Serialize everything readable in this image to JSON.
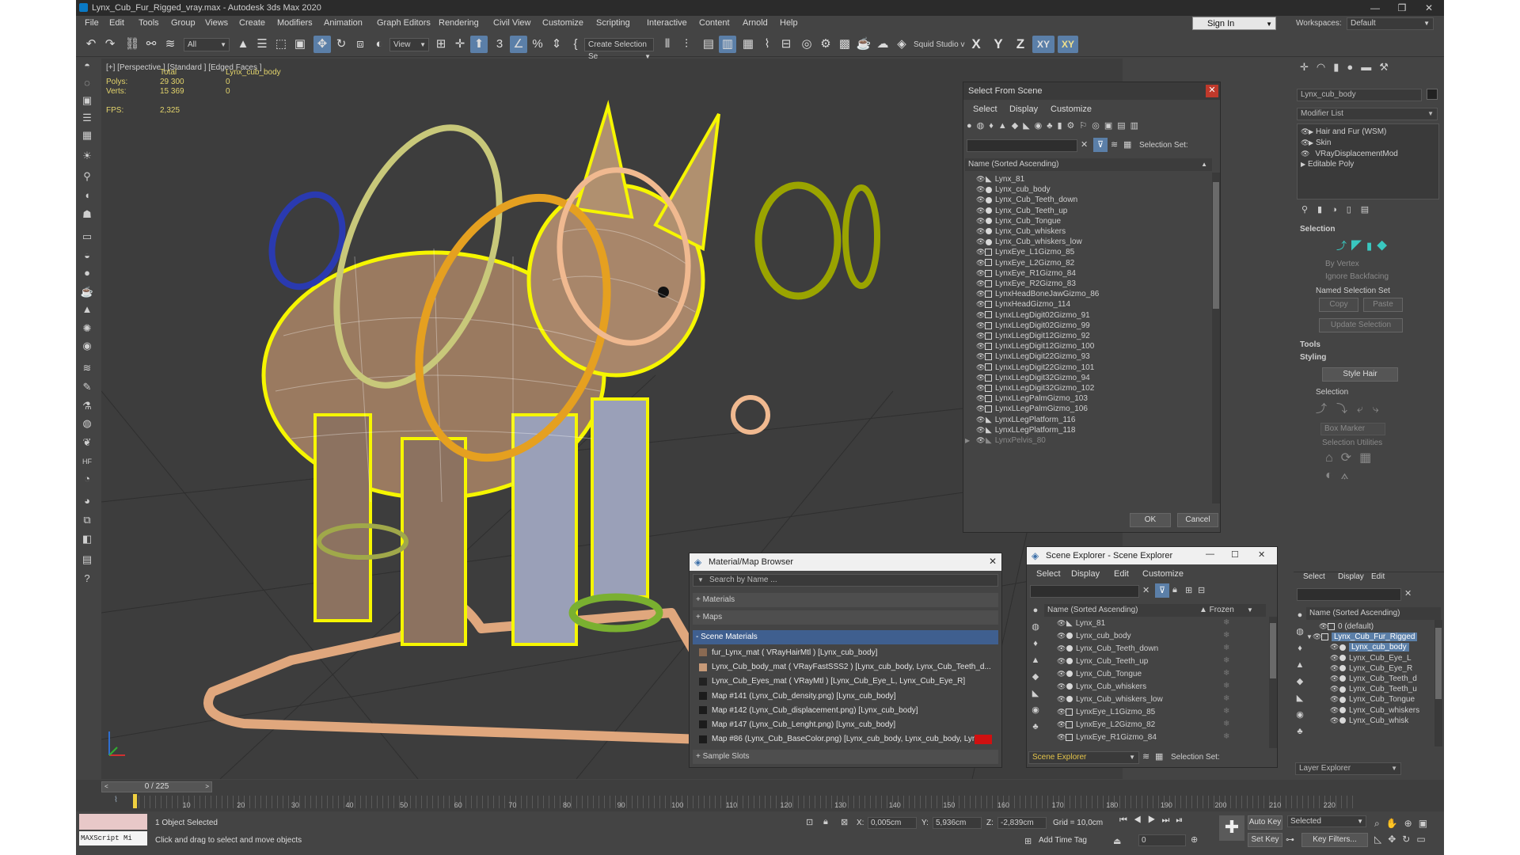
{
  "window": {
    "title": "Lynx_Cub_Fur_Rigged_vray.max - Autodesk 3ds Max 2020",
    "controls": [
      "—",
      "❒",
      "✕"
    ]
  },
  "menu": [
    "File",
    "Edit",
    "Tools",
    "Group",
    "Views",
    "Create",
    "Modifiers",
    "Animation",
    "Graph Editors",
    "Rendering",
    "Civil View",
    "Customize",
    "Scripting",
    "Interactive",
    "Content",
    "Arnold",
    "Help"
  ],
  "account": {
    "signin": "Sign In",
    "workspace_label": "Workspaces:",
    "workspace_value": "Default"
  },
  "toolbar": {
    "filter": "All",
    "refcoord": "View",
    "selection_set": "Create Selection Se",
    "workspace_text": "Squid Studio v",
    "axes": [
      "X",
      "Y",
      "Z",
      "XY",
      "XY"
    ]
  },
  "viewport": {
    "label": "[+] [Perspective ] [Standard ] [Edged Faces ]",
    "stats": {
      "col_total": "Total",
      "col_object": "Lynx_cub_body",
      "polys_label": "Polys:",
      "polys_total": "29 300",
      "polys_obj": "0",
      "verts_label": "Verts:",
      "verts_total": "15 369",
      "verts_obj": "0",
      "fps_label": "FPS:",
      "fps_value": "2,325"
    }
  },
  "select_from_scene": {
    "title": "Select From Scene",
    "menu": [
      "Select",
      "Display",
      "Customize"
    ],
    "selection_set_label": "Selection Set:",
    "column": "Name (Sorted Ascending)",
    "rows": [
      {
        "name": "Lynx_81",
        "kind": "bone"
      },
      {
        "name": "Lynx_cub_body",
        "kind": "obj"
      },
      {
        "name": "Lynx_Cub_Teeth_down",
        "kind": "obj"
      },
      {
        "name": "Lynx_Cub_Teeth_up",
        "kind": "obj"
      },
      {
        "name": "Lynx_Cub_Tongue",
        "kind": "obj"
      },
      {
        "name": "Lynx_Cub_whiskers",
        "kind": "obj"
      },
      {
        "name": "Lynx_Cub_whiskers_low",
        "kind": "obj"
      },
      {
        "name": "LynxEye_L1Gizmo_85",
        "kind": "gizmo"
      },
      {
        "name": "LynxEye_L2Gizmo_82",
        "kind": "gizmo"
      },
      {
        "name": "LynxEye_R1Gizmo_84",
        "kind": "gizmo"
      },
      {
        "name": "LynxEye_R2Gizmo_83",
        "kind": "gizmo"
      },
      {
        "name": "LynxHeadBoneJawGizmo_86",
        "kind": "gizmo"
      },
      {
        "name": "LynxHeadGizmo_114",
        "kind": "gizmo"
      },
      {
        "name": "LynxLLegDigit02Gizmo_91",
        "kind": "gizmo"
      },
      {
        "name": "LynxLLegDigit02Gizmo_99",
        "kind": "gizmo"
      },
      {
        "name": "LynxLLegDigit12Gizmo_92",
        "kind": "gizmo"
      },
      {
        "name": "LynxLLegDigit12Gizmo_100",
        "kind": "gizmo"
      },
      {
        "name": "LynxLLegDigit22Gizmo_93",
        "kind": "gizmo"
      },
      {
        "name": "LynxLLegDigit22Gizmo_101",
        "kind": "gizmo"
      },
      {
        "name": "LynxLLegDigit32Gizmo_94",
        "kind": "gizmo"
      },
      {
        "name": "LynxLLegDigit32Gizmo_102",
        "kind": "gizmo"
      },
      {
        "name": "LynxLLegPalmGizmo_103",
        "kind": "gizmo"
      },
      {
        "name": "LynxLLegPalmGizmo_106",
        "kind": "gizmo"
      },
      {
        "name": "LynxLLegPlatform_116",
        "kind": "bone"
      },
      {
        "name": "LynxLLegPlatform_118",
        "kind": "bone"
      },
      {
        "name": "LynxPelvis_80",
        "kind": "bone"
      }
    ],
    "ok": "OK",
    "cancel": "Cancel"
  },
  "material_browser": {
    "title": "Material/Map Browser",
    "search_placeholder": "Search by Name ...",
    "sections": [
      "+ Materials",
      "+ Maps",
      "- Scene Materials",
      "+ Sample Slots"
    ],
    "items": [
      "fur_Lynx_mat  ( VRayHairMtl )  [Lynx_cub_body]",
      "Lynx_Cub_body_mat  ( VRayFastSSS2 )  [Lynx_cub_body, Lynx_Cub_Teeth_d...",
      "Lynx_Cub_Eyes_mat  ( VRayMtl )  [Lynx_Cub_Eye_L, Lynx_Cub_Eye_R]",
      "Map #141 (Lynx_Cub_density.png)  [Lynx_cub_body]",
      "Map #142 (Lynx_Cub_displacement.png)  [Lynx_cub_body]",
      "Map #147 (Lynx_Cub_Lenght.png)  [Lynx_cub_body]",
      "Map #86 (Lynx_Cub_BaseColor.png)  [Lynx_cub_body, Lynx_cub_body, Lynx..."
    ]
  },
  "scene_explorer": {
    "title": "Scene Explorer - Scene Explorer",
    "menu": [
      "Select",
      "Display",
      "Edit",
      "Customize"
    ],
    "column": "Name (Sorted Ascending)",
    "column2": "▲ Frozen",
    "rows": [
      {
        "name": "Lynx_81",
        "kind": "bone"
      },
      {
        "name": "Lynx_cub_body",
        "kind": "obj"
      },
      {
        "name": "Lynx_Cub_Teeth_down",
        "kind": "obj"
      },
      {
        "name": "Lynx_Cub_Teeth_up",
        "kind": "obj"
      },
      {
        "name": "Lynx_Cub_Tongue",
        "kind": "obj"
      },
      {
        "name": "Lynx_Cub_whiskers",
        "kind": "obj"
      },
      {
        "name": "Lynx_Cub_whiskers_low",
        "kind": "obj"
      },
      {
        "name": "LynxEye_L1Gizmo_85",
        "kind": "gizmo"
      },
      {
        "name": "LynxEye_L2Gizmo_82",
        "kind": "gizmo"
      },
      {
        "name": "LynxEye_R1Gizmo_84",
        "kind": "gizmo"
      }
    ],
    "footer_dropdown": "Scene Explorer",
    "footer_label": "Selection Set:"
  },
  "command_panel": {
    "object_name": "Lynx_cub_body",
    "modifier_list": "Modifier List",
    "stack": [
      "Hair and Fur (WSM)",
      "Skin",
      "VRayDisplacementMod",
      "Editable Poly"
    ],
    "selection_title": "Selection",
    "by_vertex": "By Vertex",
    "ignore_backfacing": "Ignore Backfacing",
    "named_sel": "Named Selection Set",
    "copy": "Copy",
    "paste": "Paste",
    "update_selection": "Update Selection",
    "tools_title": "Tools",
    "styling_title": "Styling",
    "style_hair": "Style Hair",
    "selection_sub": "Selection",
    "box_marker": "Box Marker",
    "selection_utilities": "Selection Utilities"
  },
  "layer_explorer": {
    "menu": [
      "Select",
      "Display",
      "Edit"
    ],
    "column": "Name (Sorted Ascending)",
    "rows": [
      "0 (default)",
      "Lynx_Cub_Fur_Rigged",
      "Lynx_cub_body",
      "Lynx_Cub_Eye_L",
      "Lynx_Cub_Eye_R",
      "Lynx_Cub_Teeth_d",
      "Lynx_Cub_Teeth_u",
      "Lynx_Cub_Tongue",
      "Lynx_Cub_whiskers",
      "Lynx_Cub_whisk"
    ],
    "footer": "Layer Explorer"
  },
  "timeline": {
    "frame": "0 / 225",
    "ticks": [
      "10",
      "20",
      "30",
      "40",
      "50",
      "60",
      "70",
      "80",
      "90",
      "100",
      "110",
      "120",
      "130",
      "140",
      "150",
      "160",
      "170",
      "180",
      "190",
      "200",
      "210",
      "220"
    ]
  },
  "status": {
    "maxscript": "MAXScript Mi",
    "selected": "1 Object Selected",
    "prompt": "Click and drag to select and move objects",
    "x_label": "X:",
    "x": "0,005cm",
    "y_label": "Y:",
    "y": "5,936cm",
    "z_label": "Z:",
    "z": "-2,839cm",
    "grid": "Grid = 10,0cm",
    "add_time_tag": "Add Time Tag",
    "auto_key": "Auto Key",
    "set_key": "Set Key",
    "key_mode": "Selected",
    "key_filters": "Key Filters...",
    "frame_field": "0"
  }
}
